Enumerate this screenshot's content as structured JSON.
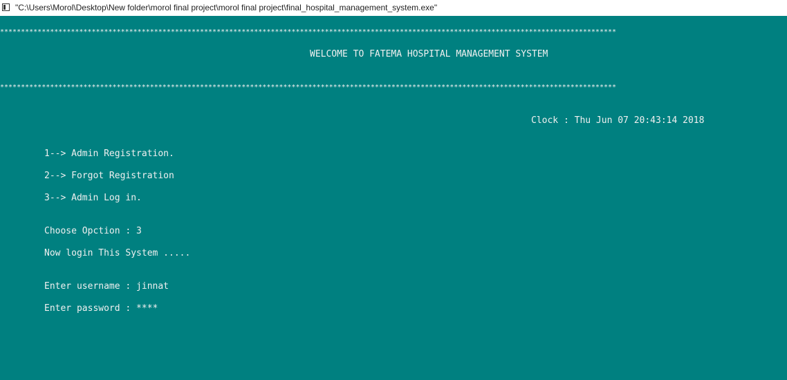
{
  "window": {
    "title": "\"C:\\Users\\Morol\\Desktop\\New folder\\morol final project\\morol final project\\final_hospital_management_system.exe\""
  },
  "console": {
    "separator": "****************************************************************************************************************************************************",
    "welcome": "WELCOME TO FATEMA HOSPITAL MANAGEMENT SYSTEM",
    "clock": "Clock : Thu Jun 07 20:43:14 2018",
    "menu": [
      "1--> Admin Registration.",
      "2--> Forgot Registration",
      "3--> Admin Log in."
    ],
    "choose_option": "Choose Opction : 3",
    "login_message": "Now login This System .....",
    "username_prompt": "Enter username : jinnat",
    "password_prompt": "Enter password : ****"
  },
  "colors": {
    "console_background": "#008080",
    "console_text": "#f0f0f0",
    "titlebar_background": "#ffffff"
  }
}
